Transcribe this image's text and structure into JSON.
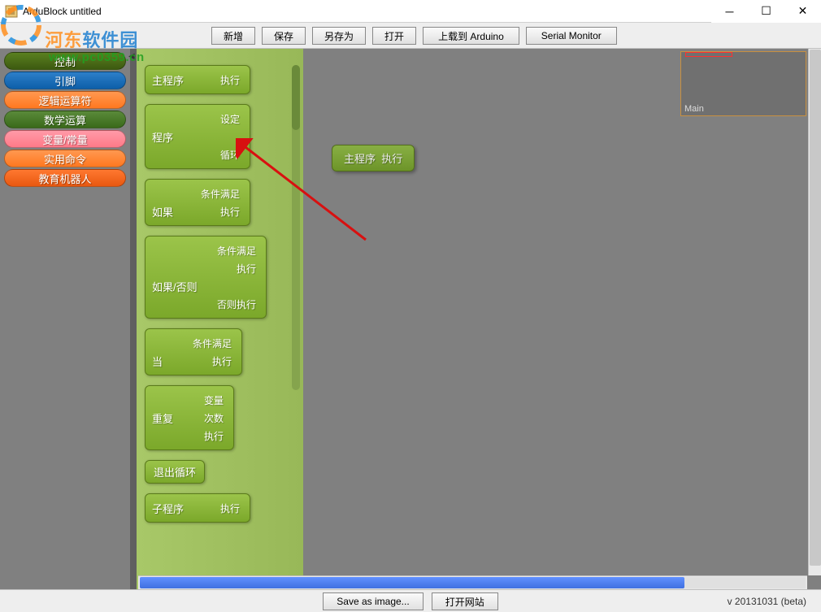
{
  "window": {
    "title": "ArduBlock untitled"
  },
  "toolbar": {
    "new": "新增",
    "save": "保存",
    "saveas": "另存为",
    "open": "打开",
    "upload": "上载到 Arduino",
    "serial": "Serial Monitor"
  },
  "categories": [
    {
      "label": "控制",
      "cls": "cat-green active"
    },
    {
      "label": "引脚",
      "cls": "cat-blue"
    },
    {
      "label": "逻辑运算符",
      "cls": "cat-orange"
    },
    {
      "label": "数学运算",
      "cls": "cat-darkgreen"
    },
    {
      "label": "变量/常量",
      "cls": "cat-pink"
    },
    {
      "label": "实用命令",
      "cls": "cat-orange"
    },
    {
      "label": "教育机器人",
      "cls": "cat-darkorange"
    }
  ],
  "blocks": {
    "mainprog": {
      "main": "主程序",
      "slot1": "执行"
    },
    "prog": {
      "main": "程序",
      "slot1": "设定",
      "slot2": "循环"
    },
    "if": {
      "main": "如果",
      "slot1": "条件满足",
      "slot2": "执行"
    },
    "ifelse": {
      "main": "如果/否则",
      "slot1": "条件满足",
      "slot2": "执行",
      "slot3": "否则执行"
    },
    "while": {
      "main": "当",
      "slot1": "条件满足",
      "slot2": "执行"
    },
    "repeat": {
      "main": "重复",
      "slot1": "变量",
      "slot2": "次数",
      "slot3": "执行"
    },
    "break": {
      "main": "退出循环"
    },
    "subprog": {
      "main": "子程序",
      "slot1": "执行"
    }
  },
  "canvas_block": {
    "main": "主程序",
    "slot1": "执行"
  },
  "minimap": {
    "label": "Main"
  },
  "bottom": {
    "saveimg": "Save as image...",
    "openweb": "打开网站",
    "version": "v 20131031 (beta)"
  },
  "watermark": {
    "site_cn": "河东软件园",
    "url": "www.pc0359.cn"
  }
}
